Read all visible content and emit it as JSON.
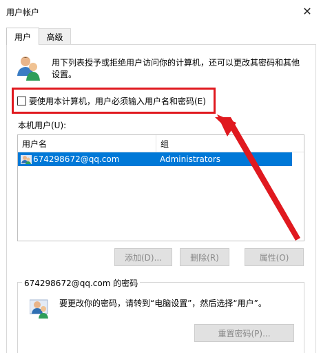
{
  "window": {
    "title": "用户帐户"
  },
  "tabs": [
    {
      "label": "用户",
      "active": true
    },
    {
      "label": "高级",
      "active": false
    }
  ],
  "description": "用下列表授予或拒绝用户访问你的计算机，还可以更改其密码和其他设置。",
  "require_login": {
    "label": "要使用本计算机，用户必须输入用户名和密码(E)",
    "checked": false
  },
  "local_users": {
    "label": "本机用户(U):",
    "columns": [
      "用户名",
      "组"
    ],
    "rows": [
      {
        "username": "674298672@qq.com",
        "group": "Administrators",
        "selected": true
      }
    ]
  },
  "buttons": {
    "add": "添加(D)...",
    "remove": "删除(R)",
    "properties": "属性(O)",
    "reset_password": "重置密码(P)..."
  },
  "password_group": {
    "title": "674298672@qq.com 的密码",
    "text": "要更改你的密码，请转到“电脑设置”，然后选择“用户”。"
  },
  "colors": {
    "selection": "#0078d7",
    "annotation": "#e0191f"
  },
  "icons": {
    "close": "close-icon",
    "users": "users-icon",
    "user_row": "user-icon",
    "password": "user-password-icon"
  }
}
